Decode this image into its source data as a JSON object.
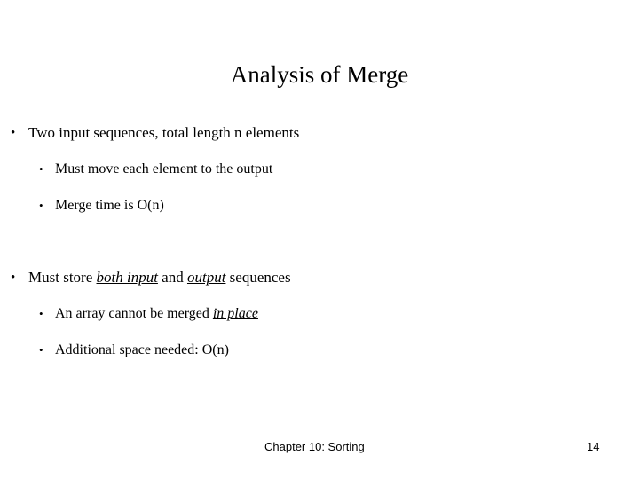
{
  "slide": {
    "title": "Analysis of Merge",
    "background_color": "#ffffff",
    "text_color": "#000000",
    "bullet_glyph": "•",
    "content": [
      {
        "level": 1,
        "runs": [
          {
            "text": "Two input sequences, total length n elements",
            "italic": false,
            "underline": false
          }
        ]
      },
      {
        "level": 2,
        "runs": [
          {
            "text": "Must move each element to the output",
            "italic": false,
            "underline": false
          }
        ]
      },
      {
        "level": 2,
        "runs": [
          {
            "text": "Merge time is O(n)",
            "italic": false,
            "underline": false
          }
        ]
      },
      {
        "level": 1,
        "runs": [
          {
            "text": "Must store ",
            "italic": false,
            "underline": false
          },
          {
            "text": "both input",
            "italic": true,
            "underline": true
          },
          {
            "text": " and ",
            "italic": false,
            "underline": false
          },
          {
            "text": "output",
            "italic": true,
            "underline": true
          },
          {
            "text": " sequences",
            "italic": false,
            "underline": false
          }
        ]
      },
      {
        "level": 2,
        "runs": [
          {
            "text": "An array cannot be merged ",
            "italic": false,
            "underline": false
          },
          {
            "text": "in place",
            "italic": true,
            "underline": true
          }
        ]
      },
      {
        "level": 2,
        "runs": [
          {
            "text": "Additional space needed: O(n)",
            "italic": false,
            "underline": false
          }
        ]
      }
    ]
  },
  "footer": {
    "text": "Chapter 10: Sorting",
    "page_number": "14"
  }
}
